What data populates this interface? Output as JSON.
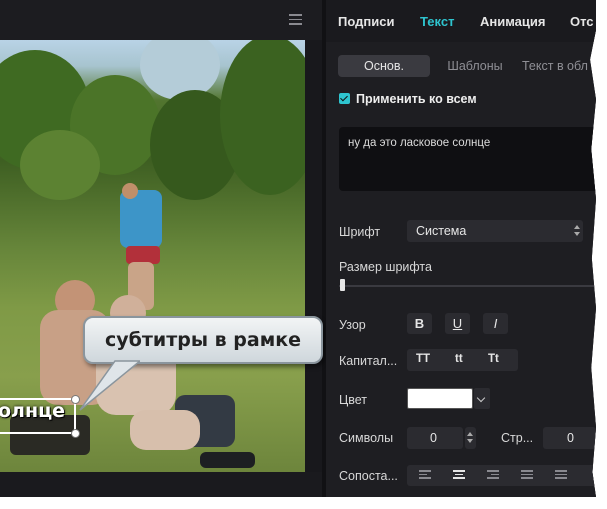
{
  "video": {
    "callout_text": "субтитры в рамке",
    "subtitle_text": "олнце"
  },
  "tabs": [
    {
      "label": "Подписи",
      "active": false
    },
    {
      "label": "Текст",
      "active": true
    },
    {
      "label": "Анимация",
      "active": false
    },
    {
      "label": "Отс",
      "active": false
    }
  ],
  "segments": [
    {
      "label": "Основ.",
      "active": true
    },
    {
      "label": "Шаблоны",
      "active": false
    },
    {
      "label": "Текст в обл",
      "active": false
    }
  ],
  "apply_all": {
    "label": "Применить ко всем",
    "checked": true
  },
  "text_content": "ну да это ласковое солнце",
  "font": {
    "label": "Шрифт",
    "value": "Система"
  },
  "font_size": {
    "label": "Размер шрифта",
    "level": 0.0
  },
  "style": {
    "label": "Узор",
    "bold": "B",
    "underline": "U",
    "italic": "I"
  },
  "capitalization": {
    "label": "Капитал...",
    "upper": "TT",
    "lower": "tt",
    "title": "Tt"
  },
  "color": {
    "label": "Цвет",
    "value": "#ffffff"
  },
  "symbols": {
    "label": "Символы",
    "value": "0"
  },
  "lines": {
    "label": "Стр...",
    "value": "0"
  },
  "alignment": {
    "label": "Сопоста..."
  },
  "accent_color": "#2ec4cf"
}
